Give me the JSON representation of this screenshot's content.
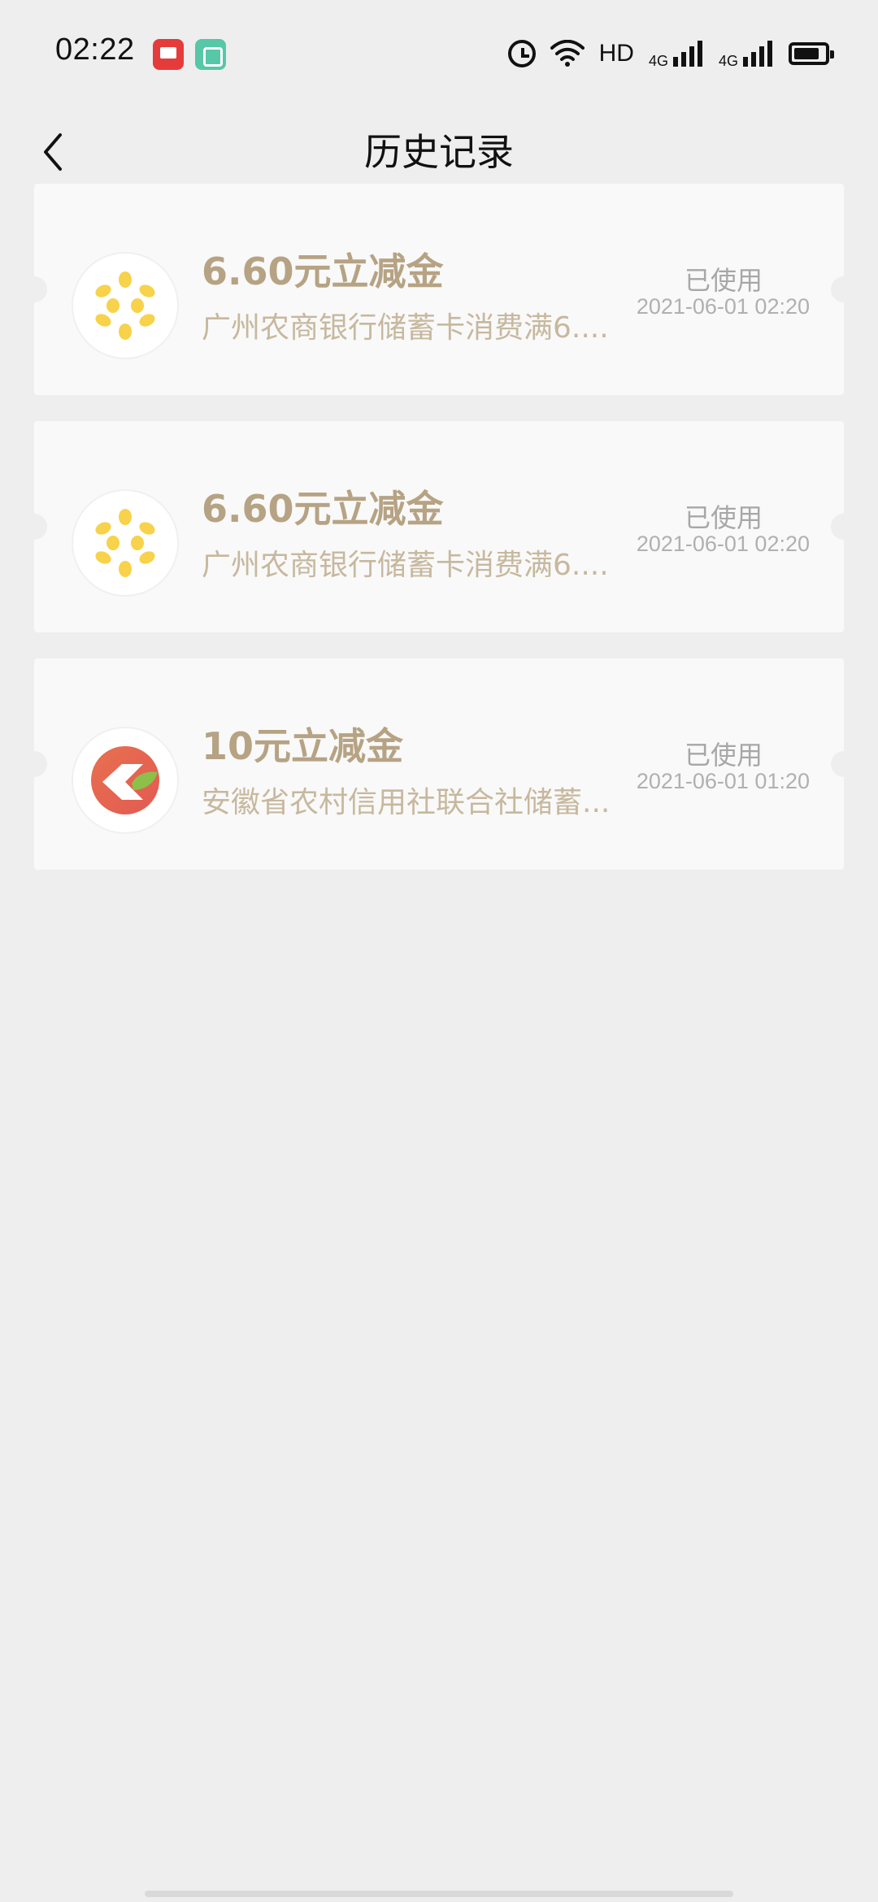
{
  "status_bar": {
    "time": "02:22",
    "hd_label": "HD",
    "net1": "4G",
    "net2": "4G"
  },
  "header": {
    "title": "历史记录"
  },
  "coupons": [
    {
      "title": "6.60元立减金",
      "desc": "广州农商银行储蓄卡消费满6....",
      "status": "已使用",
      "time": "2021-06-01 02:20",
      "logo": "grcb-logo-icon"
    },
    {
      "title": "6.60元立减金",
      "desc": "广州农商银行储蓄卡消费满6....",
      "status": "已使用",
      "time": "2021-06-01 02:20",
      "logo": "grcb-logo-icon"
    },
    {
      "title": "10元立减金",
      "desc": "安徽省农村信用社联合社储蓄...",
      "status": "已使用",
      "time": "2021-06-01 01:20",
      "logo": "ahrcu-logo-icon"
    }
  ],
  "colors": {
    "background": "#eeeeee",
    "card": "#f9f9f9",
    "title": "#b6a384",
    "desc": "#c7b89e",
    "status": "#a7a7a7"
  }
}
